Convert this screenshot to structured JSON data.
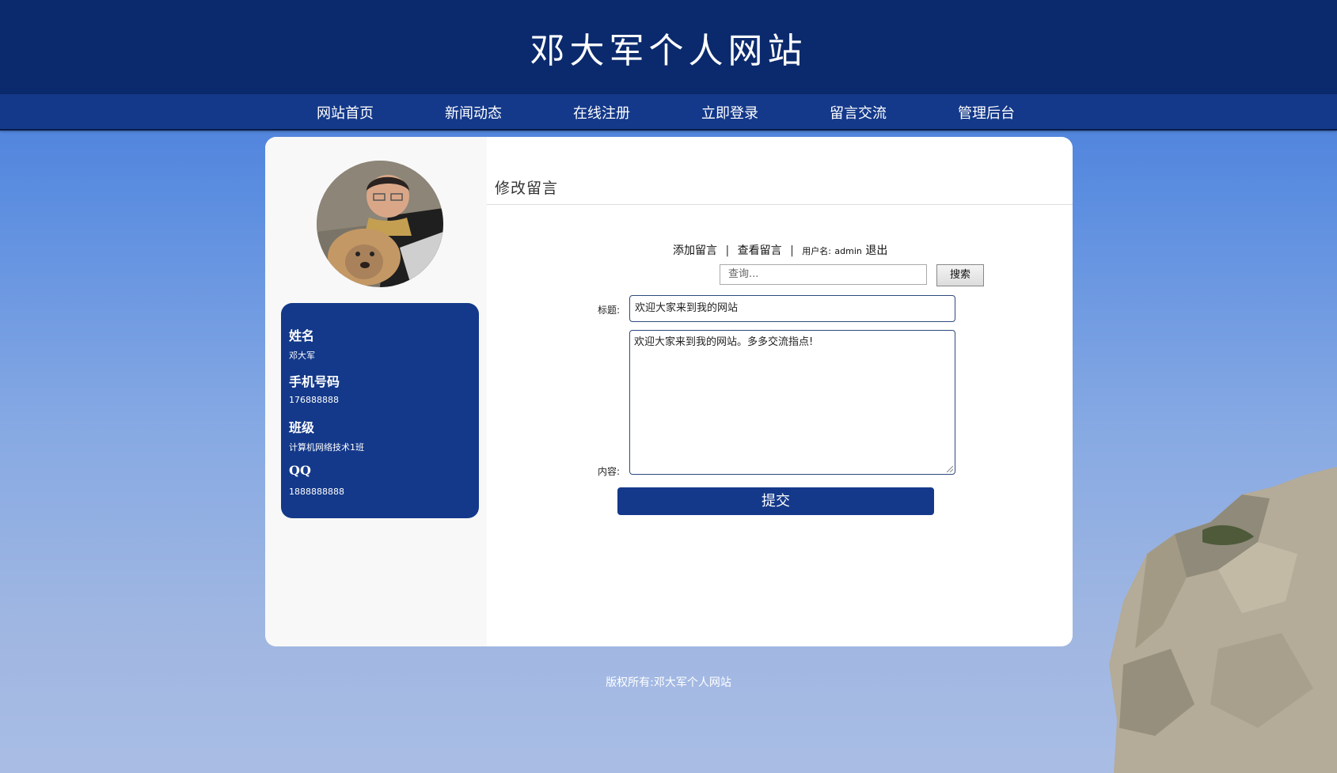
{
  "site": {
    "title": "邓大军个人网站"
  },
  "nav": {
    "items": [
      {
        "label": "网站首页"
      },
      {
        "label": "新闻动态"
      },
      {
        "label": "在线注册"
      },
      {
        "label": "立即登录"
      },
      {
        "label": "留言交流"
      },
      {
        "label": "管理后台"
      }
    ]
  },
  "profile": {
    "fields": [
      {
        "label": "姓名",
        "value": "邓大军"
      },
      {
        "label": "手机号码",
        "value": "176888888"
      },
      {
        "label": "班级",
        "value": "计算机网络技术1班"
      },
      {
        "label": "QQ",
        "value": "1888888888"
      }
    ]
  },
  "main": {
    "section_title": "修改留言",
    "links": {
      "add": "添加留言",
      "view": "查看留言",
      "separator": "|",
      "username_label": "用户名:",
      "username": "admin",
      "logout": "退出"
    },
    "search": {
      "placeholder": "查询...",
      "button": "搜索"
    },
    "form": {
      "title_label": "标题:",
      "title_value": "欢迎大家来到我的网站",
      "content_label": "内容:",
      "content_value": "欢迎大家来到我的网站。多多交流指点!",
      "submit": "提交"
    }
  },
  "footer": {
    "text": "版权所有:邓大军个人网站"
  },
  "colors": {
    "header": "#0b2a6d",
    "nav": "#14398a",
    "accent": "#14398a"
  }
}
